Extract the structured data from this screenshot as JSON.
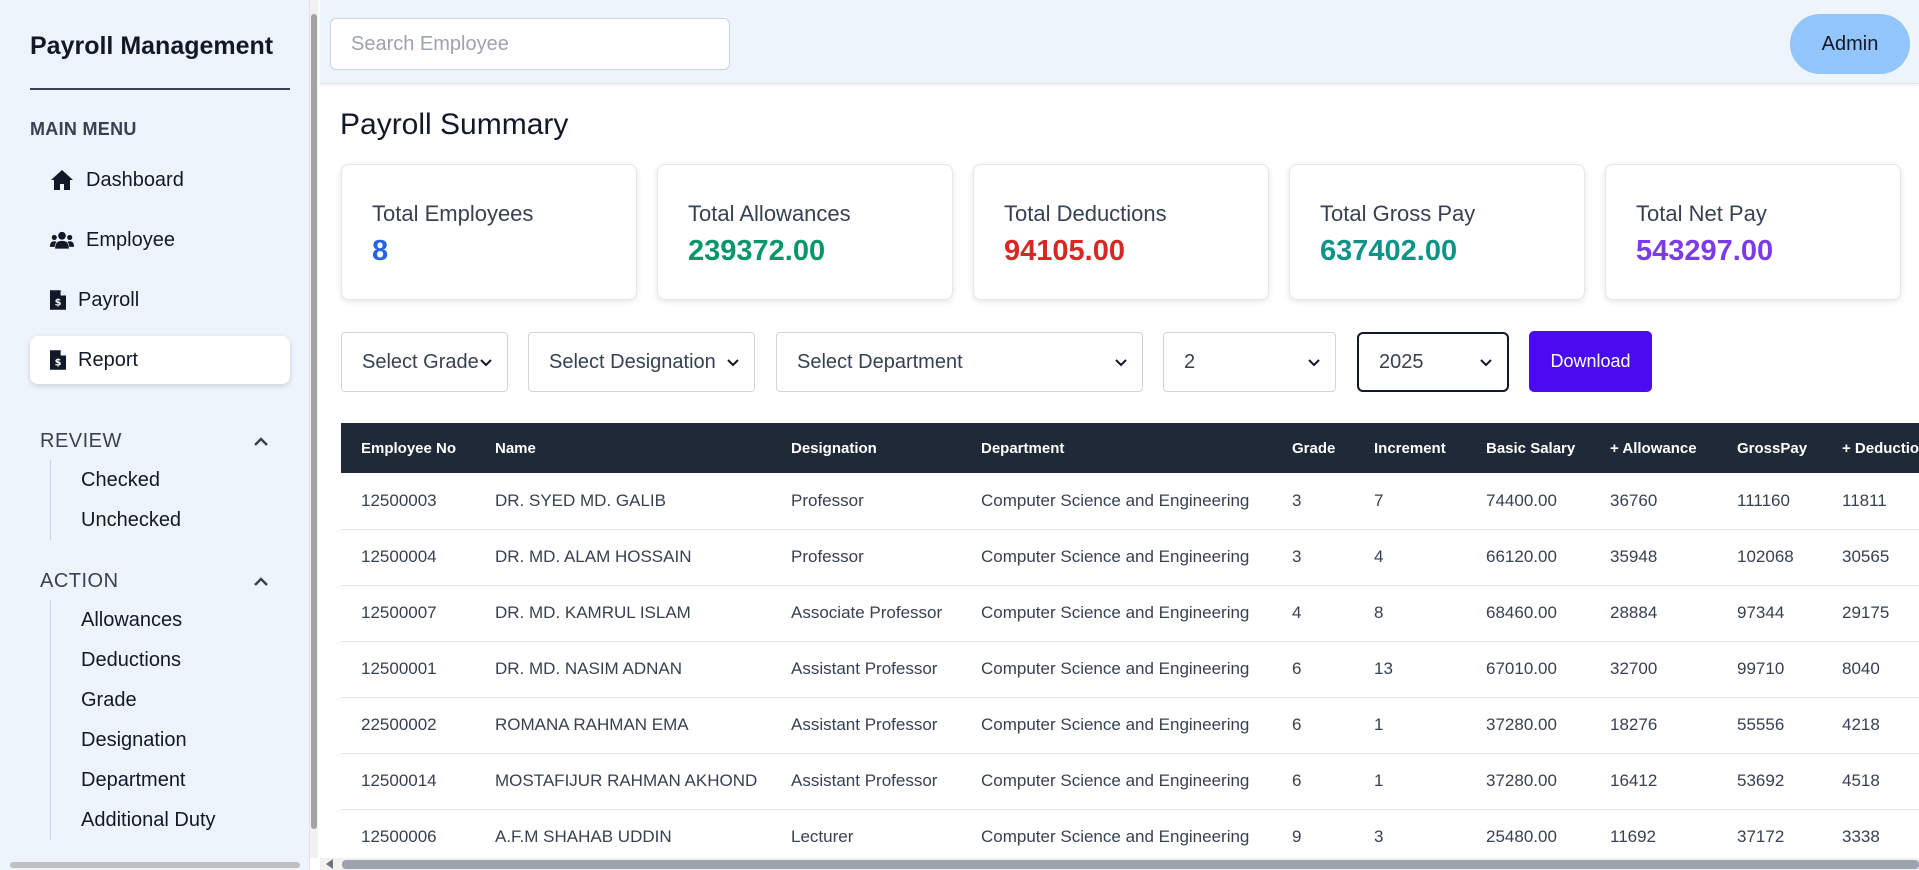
{
  "sidebar": {
    "brand": "Payroll Management",
    "main_menu_title": "MAIN MENU",
    "main_items": [
      {
        "label": "Dashboard",
        "icon": "home-icon"
      },
      {
        "label": "Employee",
        "icon": "users-icon"
      },
      {
        "label": "Payroll",
        "icon": "file-invoice-dollar-icon"
      },
      {
        "label": "Report",
        "icon": "file-invoice-dollar-icon",
        "active": true
      }
    ],
    "review": {
      "title": "REVIEW",
      "items": [
        "Checked",
        "Unchecked"
      ]
    },
    "action": {
      "title": "ACTION",
      "items": [
        "Allowances",
        "Deductions",
        "Grade",
        "Designation",
        "Department",
        "Additional Duty"
      ]
    }
  },
  "header": {
    "search_placeholder": "Search Employee",
    "admin_label": "Admin"
  },
  "main": {
    "title": "Payroll Summary",
    "cards": [
      {
        "label": "Total Employees",
        "value": "8",
        "color": "#2563eb"
      },
      {
        "label": "Total Allowances",
        "value": "239372.00",
        "color": "#059669"
      },
      {
        "label": "Total Deductions",
        "value": "94105.00",
        "color": "#dc2626"
      },
      {
        "label": "Total Gross Pay",
        "value": "637402.00",
        "color": "#0d9488"
      },
      {
        "label": "Total Net Pay",
        "value": "543297.00",
        "color": "#7c3aed"
      }
    ],
    "filters": {
      "grade": "Select Grade",
      "designation": "Select Designation",
      "department": "Select Department",
      "month": "2",
      "year": "2025"
    },
    "download_label": "Download"
  },
  "table": {
    "columns": [
      "Employee No",
      "Name",
      "Designation",
      "Department",
      "Grade",
      "Increment",
      "Basic Salary",
      "+ Allowance",
      "GrossPay",
      "+ Deduction"
    ],
    "rows": [
      [
        "12500003",
        "DR. SYED MD. GALIB",
        "Professor",
        "Computer Science and Engineering",
        "3",
        "7",
        "74400.00",
        "36760",
        "111160",
        "11811"
      ],
      [
        "12500004",
        "DR. MD. ALAM HOSSAIN",
        "Professor",
        "Computer Science and Engineering",
        "3",
        "4",
        "66120.00",
        "35948",
        "102068",
        "30565"
      ],
      [
        "12500007",
        "DR. MD. KAMRUL ISLAM",
        "Associate Professor",
        "Computer Science and Engineering",
        "4",
        "8",
        "68460.00",
        "28884",
        "97344",
        "29175"
      ],
      [
        "12500001",
        "DR. MD. NASIM ADNAN",
        "Assistant Professor",
        "Computer Science and Engineering",
        "6",
        "13",
        "67010.00",
        "32700",
        "99710",
        "8040"
      ],
      [
        "22500002",
        "ROMANA RAHMAN EMA",
        "Assistant Professor",
        "Computer Science and Engineering",
        "6",
        "1",
        "37280.00",
        "18276",
        "55556",
        "4218"
      ],
      [
        "12500014",
        "MOSTAFIJUR RAHMAN AKHOND",
        "Assistant Professor",
        "Computer Science and Engineering",
        "6",
        "1",
        "37280.00",
        "16412",
        "53692",
        "4518"
      ],
      [
        "12500006",
        "A.F.M SHAHAB UDDIN",
        "Lecturer",
        "Computer Science and Engineering",
        "9",
        "3",
        "25480.00",
        "11692",
        "37172",
        "3338"
      ]
    ]
  }
}
